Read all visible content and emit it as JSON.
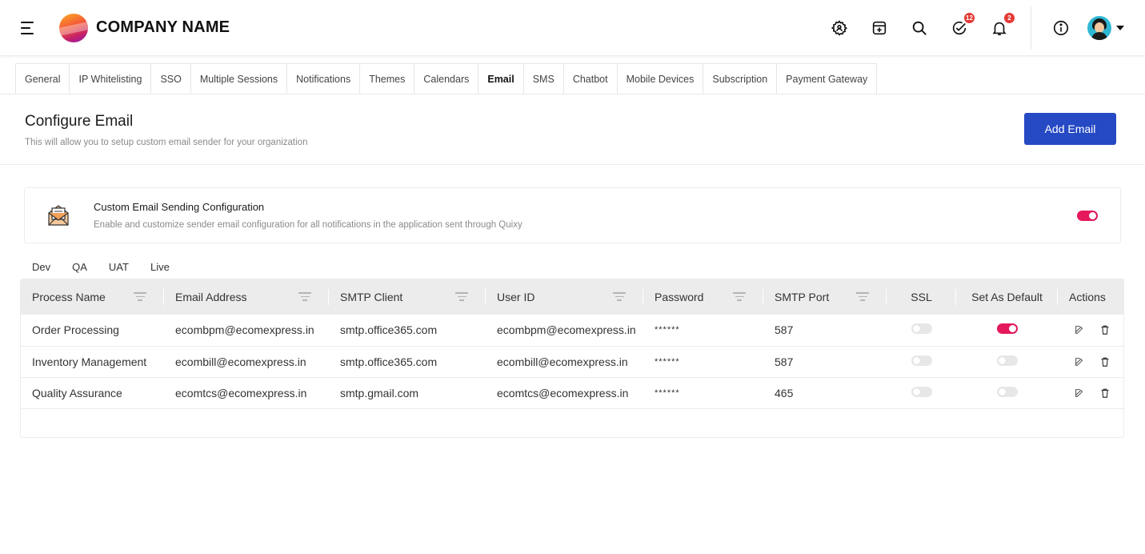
{
  "header": {
    "company_name": "COMPANY NAME",
    "tasks_badge": "12",
    "notifications_badge": "2"
  },
  "settings_tabs": [
    {
      "label": "General"
    },
    {
      "label": "IP Whitelisting"
    },
    {
      "label": "SSO"
    },
    {
      "label": "Multiple Sessions"
    },
    {
      "label": "Notifications"
    },
    {
      "label": "Themes"
    },
    {
      "label": "Calendars"
    },
    {
      "label": "Email"
    },
    {
      "label": "SMS"
    },
    {
      "label": "Chatbot"
    },
    {
      "label": "Mobile Devices"
    },
    {
      "label": "Subscription"
    },
    {
      "label": "Payment Gateway"
    }
  ],
  "active_tab": "Email",
  "configure": {
    "title": "Configure Email",
    "subtitle": "This will allow you to setup custom email sender for your organization",
    "add_button": "Add Email"
  },
  "custom_config": {
    "title": "Custom Email Sending Configuration",
    "description": "Enable and customize sender email configuration for all notifications in the application sent through Quixy",
    "enabled": true
  },
  "environments": [
    "Dev",
    "QA",
    "UAT",
    "Live"
  ],
  "table": {
    "columns": [
      "Process Name",
      "Email Address",
      "SMTP Client",
      "User ID",
      "Password",
      "SMTP Port",
      "SSL",
      "Set As Default",
      "Actions"
    ],
    "rows": [
      {
        "process": "Order Processing",
        "email": "ecombpm@ecomexpress.in",
        "smtp": "smtp.office365.com",
        "user": "ecombpm@ecomexpress.in",
        "password": "******",
        "port": "587",
        "ssl": false,
        "default": true
      },
      {
        "process": "Inventory Management",
        "email": "ecombill@ecomexpress.in",
        "smtp": "smtp.office365.com",
        "user": "ecombill@ecomexpress.in",
        "password": "******",
        "port": "587",
        "ssl": false,
        "default": false
      },
      {
        "process": "Quality Assurance",
        "email": "ecomtcs@ecomexpress.in",
        "smtp": "smtp.gmail.com",
        "user": "ecomtcs@ecomexpress.in",
        "password": "******",
        "port": "465",
        "ssl": false,
        "default": false
      }
    ]
  },
  "colors": {
    "primary": "#2649c4",
    "toggle_on": "#e5195b",
    "badge": "#e53935"
  }
}
